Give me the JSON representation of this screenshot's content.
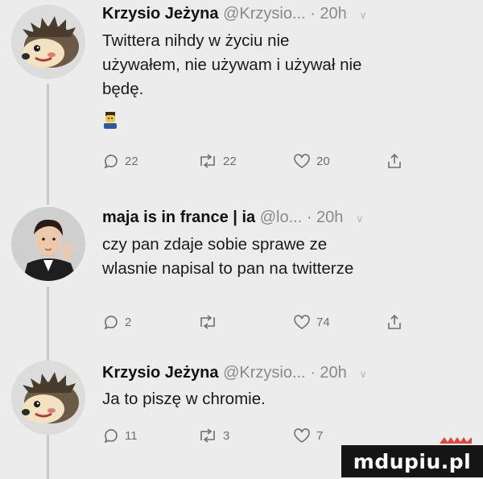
{
  "tweets": [
    {
      "name": "Krzysio Jeżyna",
      "handle": "@Krzysio...",
      "separator": "·",
      "time": "20h",
      "text_lines": [
        "Twittera nihdy w życiu nie",
        "używałem, nie używam i używał nie",
        "będę."
      ],
      "emoji": "man-emoji",
      "avatar": "hedgehog-avatar",
      "replies": "22",
      "retweets": "22",
      "likes": "20"
    },
    {
      "name": "maja is in france | ia",
      "handle": "@lo...",
      "separator": "·",
      "time": "20h",
      "text_lines": [
        "czy pan zdaje sobie sprawe ze",
        "wlasnie napisal to pan na twitterze"
      ],
      "avatar": "person-avatar",
      "replies": "2",
      "retweets": "",
      "likes": "74"
    },
    {
      "name": "Krzysio Jeżyna",
      "handle": "@Krzysio...",
      "separator": "·",
      "time": "20h",
      "text_lines": [
        "Ja to piszę w chromie."
      ],
      "avatar": "hedgehog-avatar",
      "replies": "11",
      "retweets": "3",
      "likes": "7"
    }
  ],
  "watermark": {
    "text": "mdupiu.pl"
  },
  "colors": {
    "background": "#ececec",
    "name": "#111111",
    "meta": "#8a8a8a",
    "icon": "#6e6e6e",
    "watermark_bg": "#151515"
  }
}
